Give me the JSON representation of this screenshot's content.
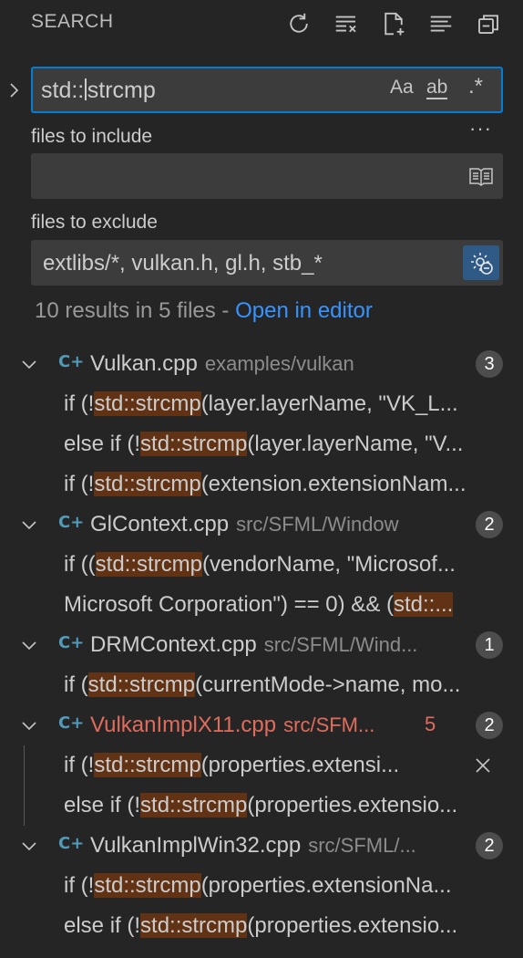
{
  "header": {
    "title": "SEARCH",
    "toolbar": [
      "refresh-icon",
      "clear-results-icon",
      "new-search-editor-icon",
      "view-as-tree-icon",
      "collapse-all-icon"
    ]
  },
  "search": {
    "query_before_cursor": "std::",
    "query_after_cursor": "strcmp",
    "match_case_label": "Aa",
    "whole_word_label": "ab",
    "regex_label": ".*",
    "more_label": "···"
  },
  "include": {
    "label": "files to include",
    "value": ""
  },
  "exclude": {
    "label": "files to exclude",
    "value": "extlibs/*, vulkan.h, gl.h, stb_*"
  },
  "summary": {
    "text": "10 results in 5 files - ",
    "link": "Open in editor"
  },
  "results": [
    {
      "file": "Vulkan.cpp",
      "path": "examples/vulkan",
      "count": "3",
      "matches": [
        {
          "pre": "if (!",
          "hit": "std::strcmp",
          "post": "(layer.layerName, \"VK_L..."
        },
        {
          "pre": "else if (!",
          "hit": "std::strcmp",
          "post": "(layer.layerName, \"V..."
        },
        {
          "pre": "if (!",
          "hit": "std::strcmp",
          "post": "(extension.extensionNam..."
        }
      ]
    },
    {
      "file": "GlContext.cpp",
      "path": "src/SFML/Window",
      "count": "2",
      "matches": [
        {
          "pre": "if ((",
          "hit": "std::strcmp",
          "post": "(vendorName, \"Microsof..."
        },
        {
          "pre": "Microsoft Corporation\") == 0) && (",
          "hit": "std::...",
          "post": ""
        }
      ]
    },
    {
      "file": "DRMContext.cpp",
      "path": "src/SFML/Wind...",
      "count": "1",
      "matches": [
        {
          "pre": "if (",
          "hit": "std::strcmp",
          "post": "(currentMode->name, mo..."
        }
      ]
    },
    {
      "file": "VulkanImplX11.cpp",
      "path": "src/SFM...",
      "modified_count": "5",
      "count": "2",
      "matches": [
        {
          "pre": "if (!",
          "hit": "std::strcmp",
          "post": "(properties.extensi..."
        },
        {
          "pre": "else if (!",
          "hit": "std::strcmp",
          "post": "(properties.extensio..."
        }
      ]
    },
    {
      "file": "VulkanImplWin32.cpp",
      "path": "src/SFML/...",
      "count": "2",
      "matches": [
        {
          "pre": "if (!",
          "hit": "std::strcmp",
          "post": "(properties.extensionNa..."
        },
        {
          "pre": "else if (!",
          "hit": "std::strcmp",
          "post": "(properties.extensio..."
        }
      ]
    }
  ],
  "colors": {
    "background": "#252526",
    "input_background": "#3c3c3c",
    "focus_border": "#007fd4",
    "link": "#3794ff",
    "match_highlight": "#613214",
    "modified_file": "#e06c5c",
    "file_icon": "#519aba"
  }
}
